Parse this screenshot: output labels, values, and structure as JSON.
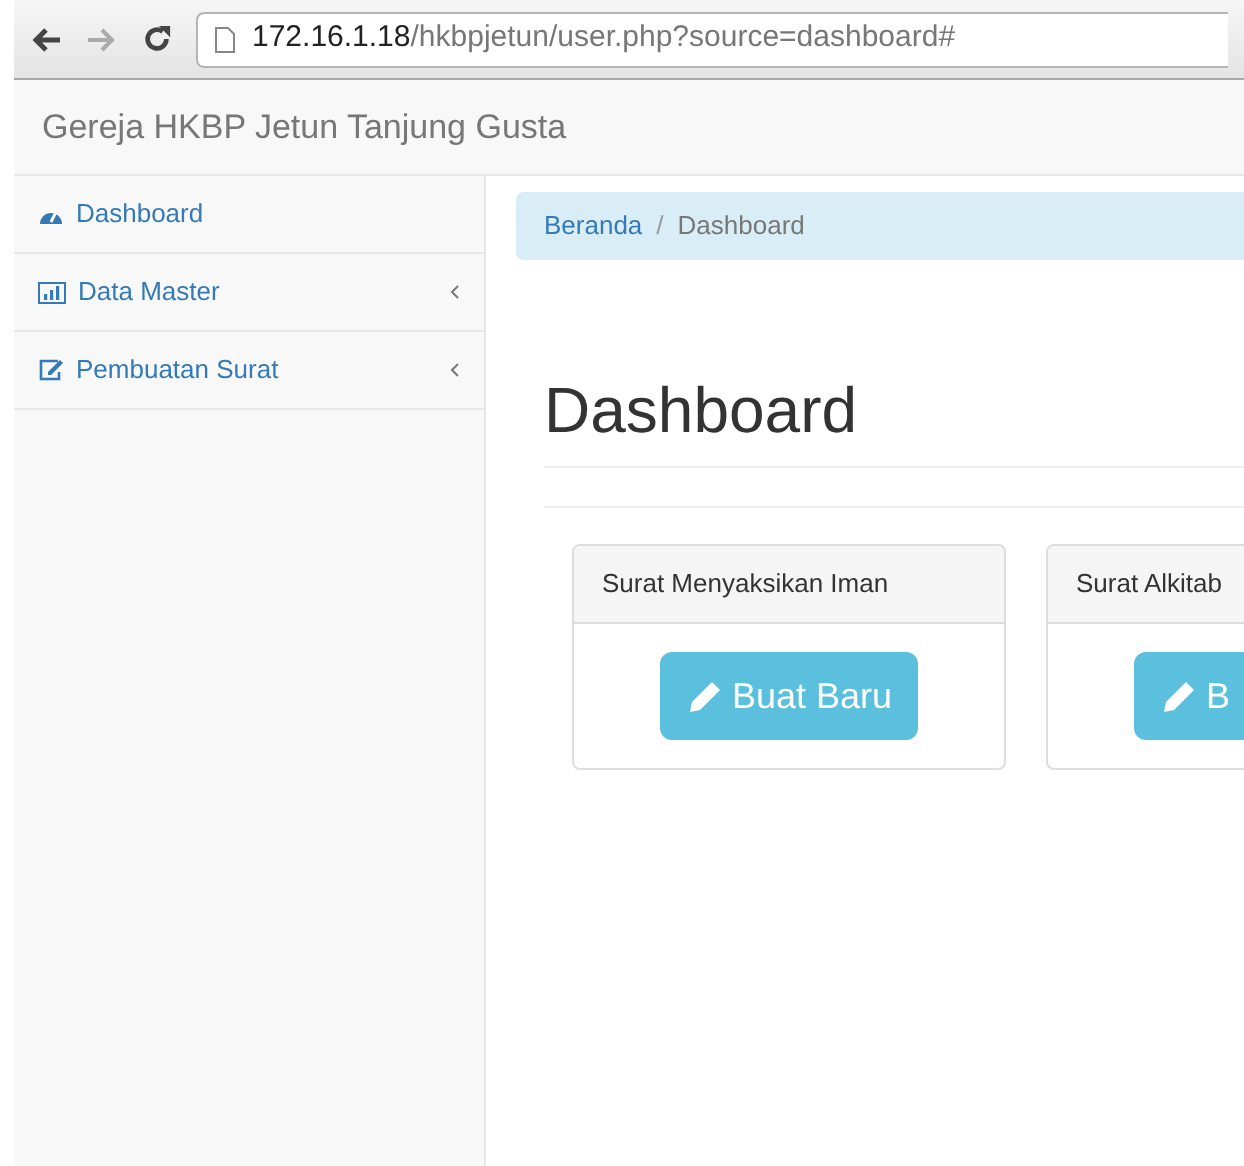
{
  "browser": {
    "url_host": "172.16.1.18",
    "url_path": "/hkbpjetun/user.php?source=dashboard#"
  },
  "navbar": {
    "brand": "Gereja HKBP Jetun Tanjung Gusta"
  },
  "sidebar": {
    "items": [
      {
        "label": "Dashboard",
        "kind": "gauge",
        "expandable": false
      },
      {
        "label": "Data Master",
        "kind": "chart",
        "expandable": true
      },
      {
        "label": "Pembuatan Surat",
        "kind": "edit",
        "expandable": true
      }
    ]
  },
  "breadcrumb": [
    {
      "label": "Beranda",
      "current": false
    },
    {
      "label": "Dashboard",
      "current": true
    }
  ],
  "breadcrumb_separator": "/",
  "page_title": "Dashboard",
  "cards": [
    {
      "title": "Surat Menyaksikan Iman",
      "button": "Buat Baru"
    },
    {
      "title": "Surat Alkitab",
      "button": "B"
    }
  ]
}
